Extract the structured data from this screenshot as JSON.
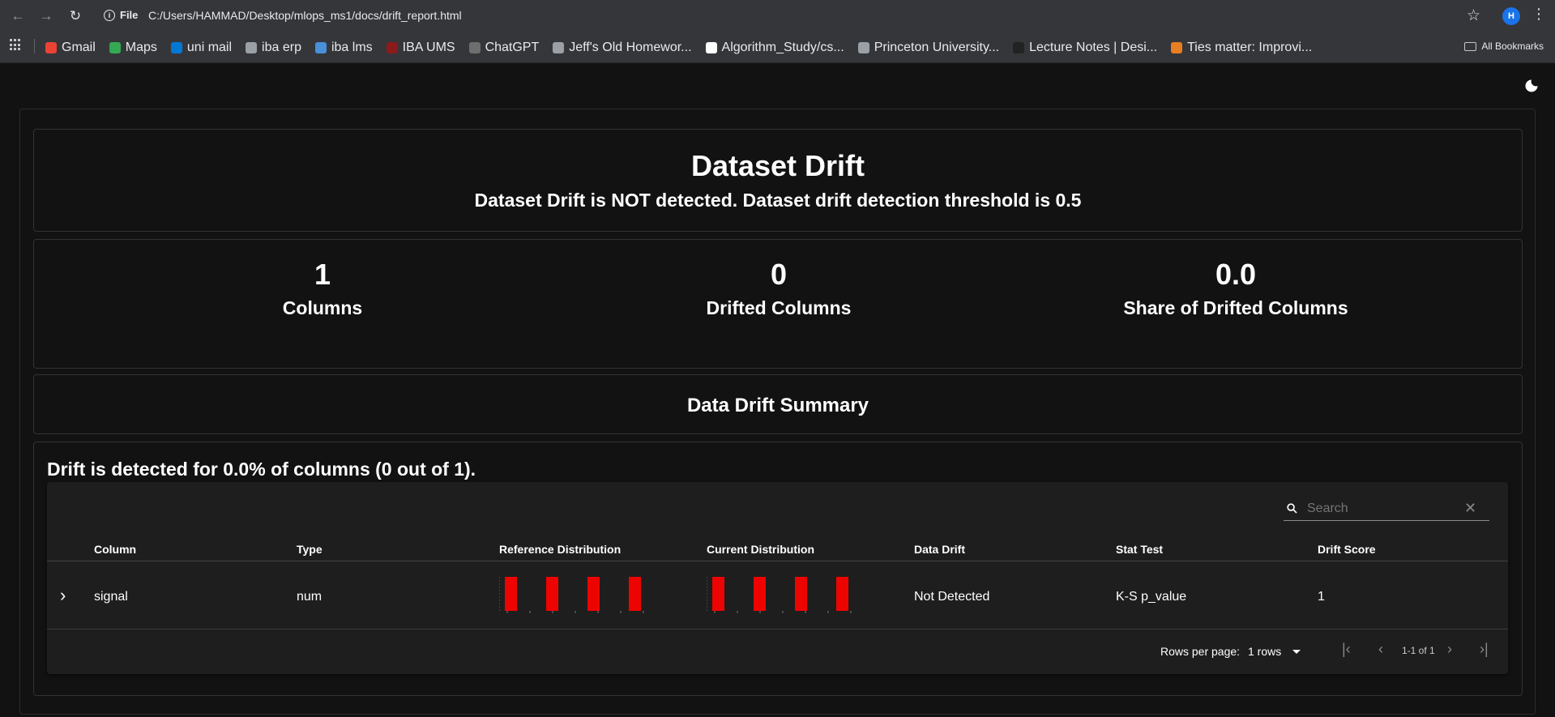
{
  "browser": {
    "site_label": "File",
    "url": "C:/Users/HAMMAD/Desktop/mlops_ms1/docs/drift_report.html",
    "profile_initial": "H",
    "bookmarks": [
      {
        "label": "Gmail",
        "icon": "gmail-icon",
        "color": "#ea4335"
      },
      {
        "label": "Maps",
        "icon": "maps-icon",
        "color": "#34a853"
      },
      {
        "label": "uni mail",
        "icon": "outlook-icon",
        "color": "#0078d4"
      },
      {
        "label": "iba erp",
        "icon": "globe-icon",
        "color": "#9aa0a6"
      },
      {
        "label": "iba lms",
        "icon": "lms-icon",
        "color": "#4a90d9"
      },
      {
        "label": "IBA UMS",
        "icon": "iba-icon",
        "color": "#8b1a1a"
      },
      {
        "label": "ChatGPT",
        "icon": "chatgpt-icon",
        "color": "#6e6e6e"
      },
      {
        "label": "Jeff's Old Homewor...",
        "icon": "globe-icon",
        "color": "#9aa0a6"
      },
      {
        "label": "Algorithm_Study/cs...",
        "icon": "github-icon",
        "color": "#ffffff"
      },
      {
        "label": "Princeton University...",
        "icon": "globe-icon",
        "color": "#9aa0a6"
      },
      {
        "label": "Lecture Notes | Desi...",
        "icon": "mit-icon",
        "color": "#222222"
      },
      {
        "label": "Ties matter: Improvi...",
        "icon": "e-icon",
        "color": "#e67e22"
      }
    ],
    "all_bookmarks_label": "All Bookmarks"
  },
  "report": {
    "title": "Dataset Drift",
    "subtitle": "Dataset Drift is NOT detected. Dataset drift detection threshold is 0.5",
    "metrics": [
      {
        "value": "1",
        "label": "Columns"
      },
      {
        "value": "0",
        "label": "Drifted Columns"
      },
      {
        "value": "0.0",
        "label": "Share of Drifted Columns"
      }
    ],
    "summary_title": "Data Drift Summary",
    "drift_statement": "Drift is detected for 0.0% of columns (0 out of 1).",
    "search_placeholder": "Search",
    "table": {
      "headers": [
        "Column",
        "Type",
        "Reference Distribution",
        "Current Distribution",
        "Data Drift",
        "Stat Test",
        "Drift Score"
      ],
      "rows": [
        {
          "column": "signal",
          "type": "num",
          "data_drift": "Not Detected",
          "stat_test": "K-S p_value",
          "drift_score": "1",
          "reference_bars": [
            1,
            1,
            1,
            1
          ],
          "current_bars": [
            1,
            1,
            1,
            1
          ],
          "bar_color": "#ed0400"
        }
      ]
    },
    "footer": {
      "rows_per_page_label": "Rows per page:",
      "rows_per_page_value": "1 rows",
      "page_range": "1-1 of 1"
    }
  }
}
